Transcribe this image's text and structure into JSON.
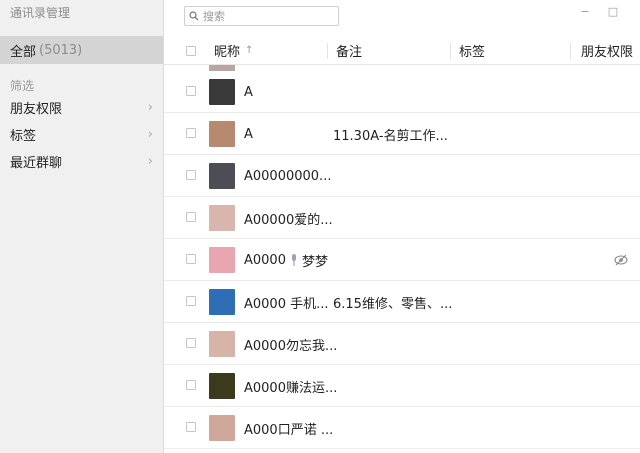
{
  "app": {
    "title": "通讯录管理"
  },
  "sidebar": {
    "all_label": "全部",
    "all_count": "(5013)",
    "filter_title": "筛选",
    "filters": [
      {
        "label": "朋友权限",
        "chevron": "›"
      },
      {
        "label": "标签",
        "chevron": "›"
      },
      {
        "label": "最近群聊",
        "chevron": "›"
      }
    ]
  },
  "search": {
    "placeholder": "搜索",
    "icon": "search-icon"
  },
  "window": {
    "minimize": "−",
    "maximize": "□"
  },
  "table": {
    "columns": [
      "昵称",
      "备注",
      "标签",
      "朋友权限"
    ],
    "sort_indicator": "↑",
    "rows": [
      {
        "name": "A",
        "remark": "",
        "avatar_color": "#3a3a3a"
      },
      {
        "name": "A",
        "remark": "11.30A-名剪工作...",
        "avatar_color": "#b58a70"
      },
      {
        "name": "A00000000...",
        "remark": "",
        "avatar_color": "#4d4d55"
      },
      {
        "name": "A00000爱的...",
        "remark": "",
        "avatar_color": "#d9b6ad"
      },
      {
        "name": "A0000",
        "name_suffix": "梦梦",
        "remark": "",
        "avatar_color": "#e8a6b0",
        "has_badge_icon": true,
        "has_permission_icon": true
      },
      {
        "name": "A0000  手机...",
        "remark": "6.15维修、零售、...",
        "avatar_color": "#2f6db5"
      },
      {
        "name": "A0000勿忘我...",
        "remark": "",
        "avatar_color": "#d6b5a8"
      },
      {
        "name": "A0000赚法运...",
        "remark": "",
        "avatar_color": "#3c3a1c"
      },
      {
        "name": "A000口严诺  ...",
        "remark": "",
        "avatar_color": "#cfa79b"
      }
    ]
  },
  "colors": {
    "sidebar_bg": "#f0f0f0",
    "selected_bg": "#d4d4d4",
    "divider": "#ececec"
  }
}
